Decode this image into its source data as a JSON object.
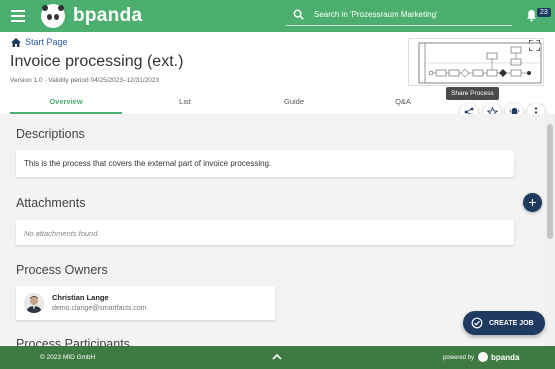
{
  "header": {
    "brand": "bpanda",
    "search_placeholder": "Search in 'Prozessraum Marketing'",
    "notification_count": "23"
  },
  "breadcrumb": {
    "label": "Start Page"
  },
  "process": {
    "title": "Invoice processing (ext.)",
    "version_line": "Version 1.0 · Validity period 04/25/2023–12/31/2023"
  },
  "tooltip": "Share Process",
  "tabs": [
    {
      "label": "Overview",
      "active": true
    },
    {
      "label": "List",
      "active": false
    },
    {
      "label": "Guide",
      "active": false
    },
    {
      "label": "Q&A",
      "active": false
    }
  ],
  "sections": {
    "descriptions": {
      "title": "Descriptions",
      "text": "This is the process that covers the external part of invoice processing."
    },
    "attachments": {
      "title": "Attachments",
      "empty": "No attachments found."
    },
    "owners": {
      "title": "Process Owners",
      "name": "Christian Lange",
      "email": "demo.clange@smartfacts.com"
    },
    "participants": {
      "title": "Process Participants"
    }
  },
  "create_job": "CREATE JOB",
  "footer": {
    "copyright": "© 2023 MID GmbH",
    "powered_by": "powered by",
    "brand": "bpanda"
  },
  "colors": {
    "header_green": "#4caf6f",
    "footer_green": "#3f7a43",
    "navy": "#1e3a5f",
    "link_blue": "#2a5aa0"
  }
}
